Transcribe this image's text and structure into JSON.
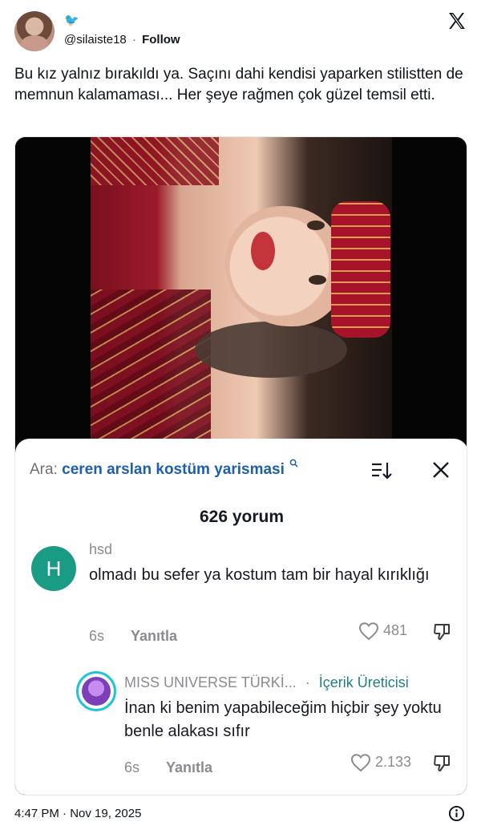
{
  "header": {
    "emoji": "🐦",
    "handle": "@silaiste18",
    "separator": "·",
    "follow_label": "Follow"
  },
  "tweet": {
    "text": "Bu kız yalnız bırakıldı ya. Saçını dahi kendisi yaparken stilistten de memnun kalamaması... Her şeye rağmen çok güzel temsil etti."
  },
  "comments_sheet": {
    "search_label": "Ara:",
    "search_query": "ceren arslan kostüm yarismasi",
    "count_label": "626 yorum",
    "comments": [
      {
        "avatar_letter": "H",
        "username": "hsd",
        "text": "olmadı bu sefer ya kostum tam bir hayal kırıklığı",
        "age": "6s",
        "reply_label": "Yanıtla",
        "likes": "481"
      },
      {
        "username": "MISS UNIVERSE TÜRKİ...",
        "separator": "·",
        "badge": "İçerik Üreticisi",
        "text": "İnan ki benim yapabileceğim hiçbir şey yoktu benle alakası sıfır",
        "age": "6s",
        "reply_label": "Yanıtla",
        "likes": "2.133"
      }
    ]
  },
  "footer": {
    "timestamp": "4:47 PM · Nov 19, 2025"
  },
  "colors": {
    "text": "#0f1419",
    "secondary": "#536471",
    "search_query": "#1c5fae",
    "comment_gray": "#8a8b91",
    "avatar_h": "#1a9b84",
    "creator_badge": "#1f7f86"
  }
}
